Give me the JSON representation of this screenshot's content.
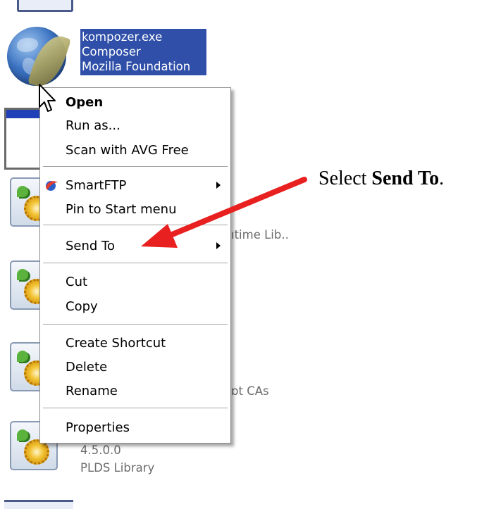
{
  "selected_file": {
    "name": "kompozer.exe",
    "description": "Composer",
    "company": "Mozilla Foundation"
  },
  "background_texts": {
    "runtime_partial": "ıtime Lib..",
    "cas_partial": "ɒt CAs",
    "version": "4.5.0.0",
    "library": "PLDS Library"
  },
  "context_menu": {
    "open": "Open",
    "run_as": "Run as...",
    "scan": "Scan with AVG Free",
    "smartftp": "SmartFTP",
    "pin": "Pin to Start menu",
    "send_to": "Send To",
    "cut": "Cut",
    "copy": "Copy",
    "create_shortcut": "Create Shortcut",
    "delete": "Delete",
    "rename": "Rename",
    "properties": "Properties"
  },
  "annotation": {
    "prefix": "Select ",
    "emphasis": "Send To",
    "suffix": "."
  },
  "colors": {
    "selection": "#2f4fa8",
    "annotation_arrow": "#e82020"
  }
}
